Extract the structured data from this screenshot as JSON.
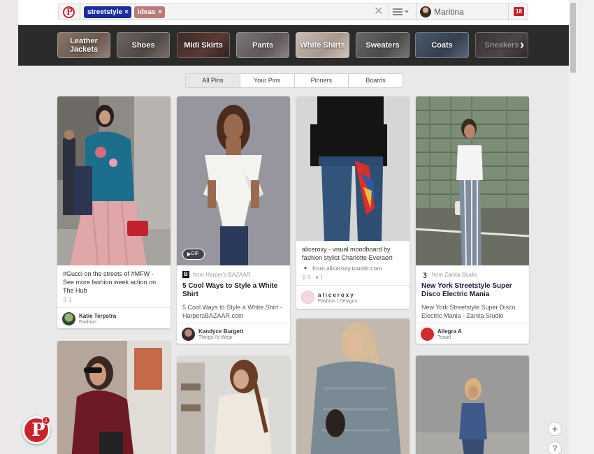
{
  "search": {
    "tokens": [
      "streetstyle",
      "ideas"
    ],
    "clear_icon": "clear-icon",
    "menu_icon": "menu-icon"
  },
  "user": {
    "name": "Maritina",
    "notifications": "18"
  },
  "categories": [
    "Leather Jackets",
    "Shoes",
    "Midi Skirts",
    "Pants",
    "White Shirts",
    "Sweaters",
    "Coats",
    "Sneakers"
  ],
  "tabs": [
    "All Pins",
    "Your Pins",
    "Pinners",
    "Boards"
  ],
  "pins": [
    {
      "desc_parts": [
        "#Gucci",
        " on the streets of ",
        "#MFW",
        " - See more fashion week action on The Hub"
      ],
      "repins": "1",
      "user": "Katie Terpstra",
      "board": "Fashion"
    },
    {
      "gif": "GIF",
      "source": "from Harper's BAZAAR",
      "source_icon": "B",
      "title": "5 Cool Ways to Style a White Shirt",
      "sub": "5 Cool Ways to Style a White Shirt - HarpersBAZAAR.com",
      "user": "Kandyce Burgett",
      "board": "Things I'd Wear"
    },
    {
      "desc": "aliceroxy - visual moodboard by fashion stylist Charlotte Everaert",
      "source": "from aliceroxy.tumblr.com",
      "repins": "6",
      "likes": "1",
      "user": "aliceroxy",
      "board": "Fashion / Designs"
    },
    {
      "source": "from Zanita Studio",
      "title": "New York Streetstyle Super Disco Electric Mania",
      "sub": "New York Streetstyle Super Disco Electric Mania - Zanita Studio",
      "user": "Allegra A",
      "board": "Travel"
    }
  ],
  "fab": {
    "badge": "1",
    "plus": "+",
    "help": "?"
  }
}
